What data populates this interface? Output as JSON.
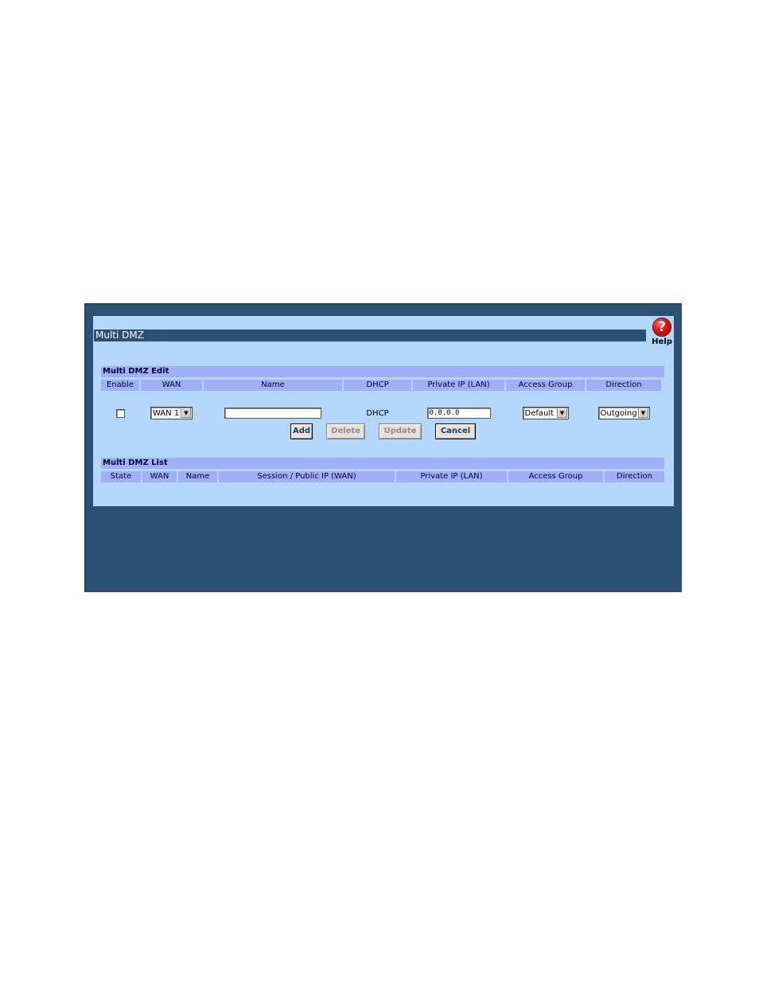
{
  "page": {
    "title": "Multi DMZ",
    "help_label": "Help",
    "help_glyph": "?"
  },
  "edit": {
    "section_title": "Multi DMZ Edit",
    "headers": [
      "Enable",
      "WAN",
      "Name",
      "DHCP",
      "Private IP (LAN)",
      "Access Group",
      "Direction"
    ],
    "row": {
      "enable_checked": false,
      "wan_selected": "WAN 1",
      "name_value": "",
      "dhcp_text": "DHCP",
      "private_ip_value": "0.0.0.0",
      "access_group_selected": "Default",
      "direction_selected": "Outgoing"
    }
  },
  "buttons": {
    "add": "Add",
    "delete": "Delete",
    "update": "Update",
    "cancel": "Cancel"
  },
  "list": {
    "section_title": "Multi DMZ List",
    "headers": [
      "State",
      "WAN",
      "Name",
      "Session / Public IP (WAN)",
      "Private IP (LAN)",
      "Access Group",
      "Direction"
    ],
    "rows": []
  },
  "icons": {
    "help": "help-icon",
    "dropdown": "chevron-down-icon"
  },
  "colors": {
    "frame_bg": "#2b5073",
    "panel_bg": "#b4d6fa",
    "header_bg": "#9fb0f8",
    "help_red": "#e01212"
  }
}
